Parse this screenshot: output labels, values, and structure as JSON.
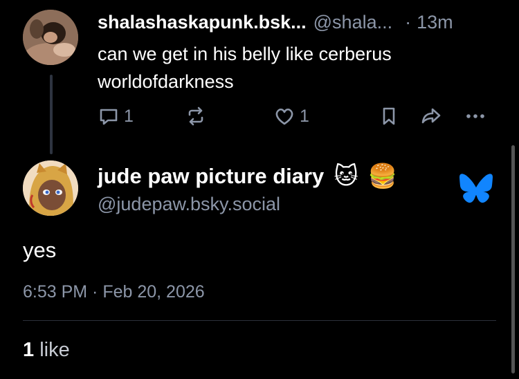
{
  "parent_post": {
    "display_name": "shalashaskapunk.bsk...",
    "handle": "@shala...",
    "separator": "·",
    "time": "13m",
    "text_line1": "can we get in his belly like cerberus",
    "text_line2": "worldofdarkness",
    "reply_count": "1",
    "like_count": "1"
  },
  "main_post": {
    "display_name": "jude paw picture diary",
    "emoji1": "🐱",
    "emoji2": "🍔",
    "handle": "@judepaw.bsky.social",
    "text": "yes",
    "timestamp": "6:53 PM · Feb 20, 2026",
    "likes_count": "1",
    "likes_label": "like"
  },
  "colors": {
    "background": "#000000",
    "muted_text": "#8c96a8",
    "brand_blue": "#1185fe"
  }
}
